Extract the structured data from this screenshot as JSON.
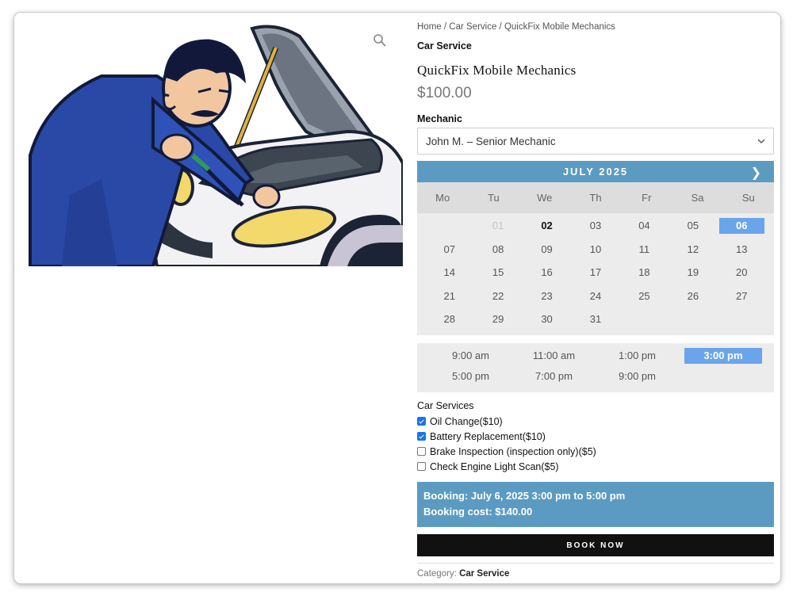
{
  "breadcrumb": {
    "home": "Home",
    "category": "Car Service",
    "current": "QuickFix Mobile Mechanics",
    "sep": " / "
  },
  "product": {
    "category_label": "Car Service",
    "title": "QuickFix Mobile Mechanics",
    "price": "$100.00"
  },
  "mechanic": {
    "label": "Mechanic",
    "selected": "John M. – Senior Mechanic"
  },
  "calendar": {
    "month_label": "JULY 2025",
    "next_icon": "chevron-right",
    "weekdays": [
      "Mo",
      "Tu",
      "We",
      "Th",
      "Fr",
      "Sa",
      "Su"
    ],
    "days": [
      {
        "d": "",
        "state": "empty"
      },
      {
        "d": "01",
        "state": "past"
      },
      {
        "d": "02",
        "state": "today"
      },
      {
        "d": "03",
        "state": "open"
      },
      {
        "d": "04",
        "state": "open"
      },
      {
        "d": "05",
        "state": "open"
      },
      {
        "d": "06",
        "state": "selected"
      },
      {
        "d": "07",
        "state": "open"
      },
      {
        "d": "08",
        "state": "open"
      },
      {
        "d": "09",
        "state": "open"
      },
      {
        "d": "10",
        "state": "open"
      },
      {
        "d": "11",
        "state": "open"
      },
      {
        "d": "12",
        "state": "open"
      },
      {
        "d": "13",
        "state": "open"
      },
      {
        "d": "14",
        "state": "open"
      },
      {
        "d": "15",
        "state": "open"
      },
      {
        "d": "16",
        "state": "open"
      },
      {
        "d": "17",
        "state": "open"
      },
      {
        "d": "18",
        "state": "open"
      },
      {
        "d": "19",
        "state": "open"
      },
      {
        "d": "20",
        "state": "open"
      },
      {
        "d": "21",
        "state": "open"
      },
      {
        "d": "22",
        "state": "open"
      },
      {
        "d": "23",
        "state": "open"
      },
      {
        "d": "24",
        "state": "open"
      },
      {
        "d": "25",
        "state": "open"
      },
      {
        "d": "26",
        "state": "open"
      },
      {
        "d": "27",
        "state": "open"
      },
      {
        "d": "28",
        "state": "open"
      },
      {
        "d": "29",
        "state": "open"
      },
      {
        "d": "30",
        "state": "open"
      },
      {
        "d": "31",
        "state": "open"
      }
    ]
  },
  "time_slots": [
    {
      "label": "9:00 am",
      "selected": false
    },
    {
      "label": "11:00 am",
      "selected": false
    },
    {
      "label": "1:00 pm",
      "selected": false
    },
    {
      "label": "3:00 pm",
      "selected": true
    },
    {
      "label": "5:00 pm",
      "selected": false
    },
    {
      "label": "7:00 pm",
      "selected": false
    },
    {
      "label": "9:00 pm",
      "selected": false
    }
  ],
  "services": {
    "title": "Car Services",
    "items": [
      {
        "label": "Oil Change($10)",
        "checked": true
      },
      {
        "label": "Battery Replacement($10)",
        "checked": true
      },
      {
        "label": "Brake Inspection (inspection only)($5)",
        "checked": false
      },
      {
        "label": "Check Engine Light Scan($5)",
        "checked": false
      }
    ]
  },
  "summary": {
    "booking": "Booking: July 6, 2025 3:00 pm to 5:00 pm",
    "cost": "Booking cost: $140.00"
  },
  "book_button": "BOOK NOW",
  "meta": {
    "category_label": "Category:",
    "category_value": "Car Service"
  },
  "colors": {
    "accent": "#5b9bc1",
    "selected": "#6aa5ec",
    "button": "#111111"
  },
  "icons": {
    "zoom": "magnifier-icon",
    "select": "chevron-down-icon"
  }
}
